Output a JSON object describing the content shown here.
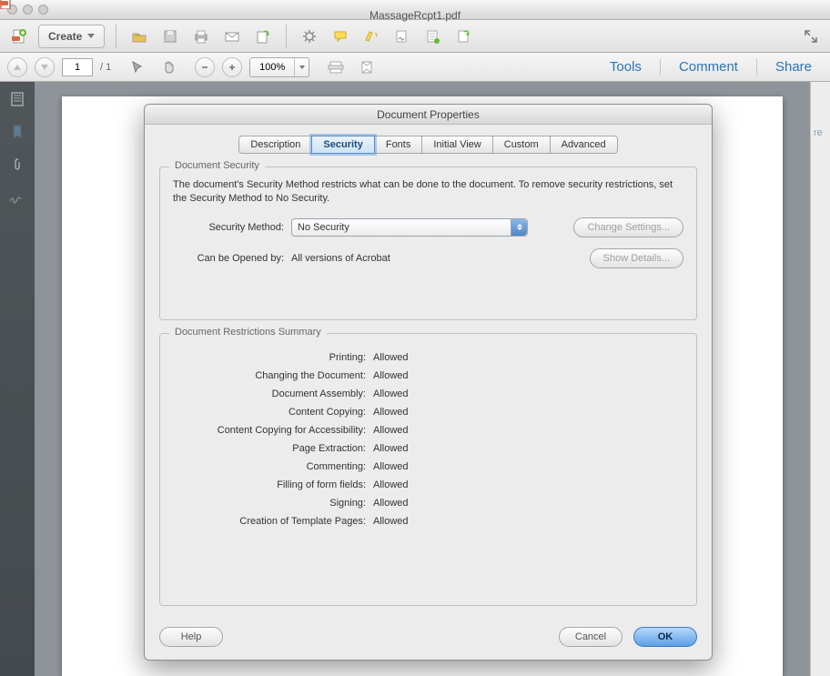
{
  "window": {
    "filename": "MassageRcpt1.pdf"
  },
  "toolbar": {
    "create": "Create"
  },
  "navbar": {
    "page": "1",
    "pageTotal": "1",
    "zoom": "100%",
    "tools": "Tools",
    "comment": "Comment",
    "share": "Share"
  },
  "rightStrip": "re",
  "dialog": {
    "title": "Document Properties",
    "tabs": [
      "Description",
      "Security",
      "Fonts",
      "Initial View",
      "Custom",
      "Advanced"
    ],
    "activeTab": 1,
    "group1": {
      "legend": "Document Security",
      "text": "The document's Security Method restricts what can be done to the document. To remove security restrictions, set the Security Method to No Security.",
      "methodLabel": "Security Method:",
      "methodValue": "No Security",
      "changeBtn": "Change Settings...",
      "openLabel": "Can be Opened by:",
      "openValue": "All versions of Acrobat",
      "detailsBtn": "Show Details..."
    },
    "group2": {
      "legend": "Document Restrictions Summary",
      "rows": [
        {
          "label": "Printing:",
          "value": "Allowed"
        },
        {
          "label": "Changing the Document:",
          "value": "Allowed"
        },
        {
          "label": "Document Assembly:",
          "value": "Allowed"
        },
        {
          "label": "Content Copying:",
          "value": "Allowed"
        },
        {
          "label": "Content Copying for Accessibility:",
          "value": "Allowed"
        },
        {
          "label": "Page Extraction:",
          "value": "Allowed"
        },
        {
          "label": "Commenting:",
          "value": "Allowed"
        },
        {
          "label": "Filling of form fields:",
          "value": "Allowed"
        },
        {
          "label": "Signing:",
          "value": "Allowed"
        },
        {
          "label": "Creation of Template Pages:",
          "value": "Allowed"
        }
      ]
    },
    "help": "Help",
    "cancel": "Cancel",
    "ok": "OK"
  }
}
